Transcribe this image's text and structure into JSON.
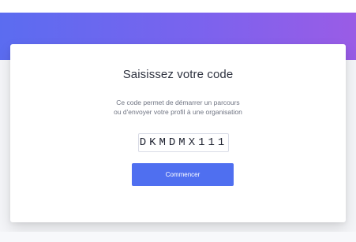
{
  "header": {
    "gradient_start": "#5b6cf0",
    "gradient_end": "#9a5ce6"
  },
  "card": {
    "title": "Saisissez votre code",
    "description_line1": "Ce code permet de démarrer un parcours",
    "description_line2": "ou d'envoyer votre profil à une organisation",
    "code_value": "DKMDMX111",
    "button_label": "Commencer",
    "button_color": "#4f6ff0"
  }
}
